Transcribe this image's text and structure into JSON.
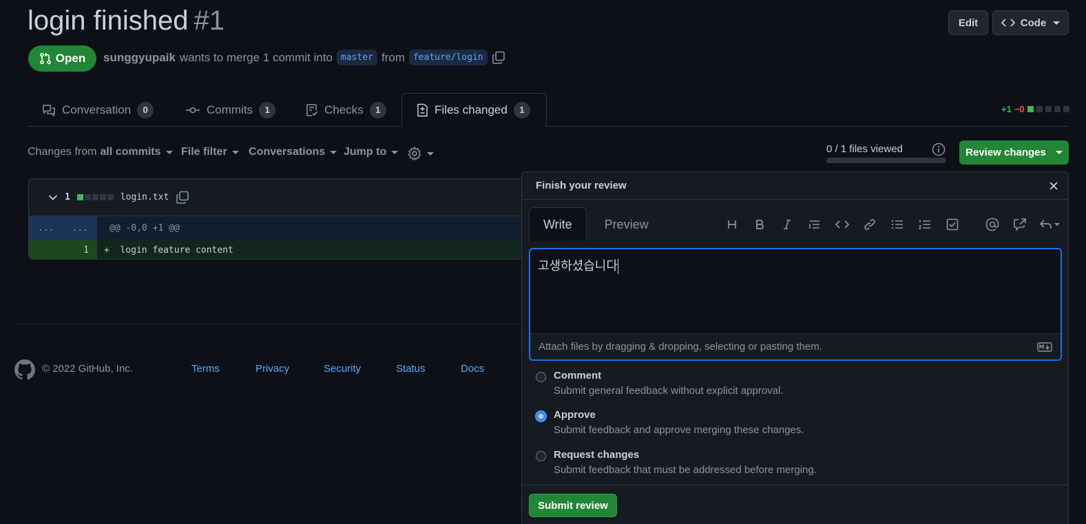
{
  "pr": {
    "title": "login finished",
    "number": "#1",
    "status": "Open",
    "author": "sunggyupaik",
    "merge_text": "wants to merge 1 commit into",
    "base_branch": "master",
    "from_text": "from",
    "head_branch": "feature/login"
  },
  "header_buttons": {
    "edit": "Edit",
    "code": "Code"
  },
  "tabs": [
    {
      "label": "Conversation",
      "count": "0"
    },
    {
      "label": "Commits",
      "count": "1"
    },
    {
      "label": "Checks",
      "count": "1"
    },
    {
      "label": "Files changed",
      "count": "1"
    }
  ],
  "diffstat": {
    "added": "+1",
    "removed": "−0",
    "colors": {
      "added": "#3fb950",
      "removed": "#f85149"
    }
  },
  "toolbar": {
    "changes_prefix": "Changes from",
    "changes_value": "all commits",
    "file_filter": "File filter",
    "conversations": "Conversations",
    "jump_to": "Jump to",
    "files_viewed": "0 / 1 files viewed",
    "review_changes": "Review changes"
  },
  "file": {
    "changes": "1",
    "name": "login.txt",
    "hunk_gutter_left": "...",
    "hunk_gutter_right": "...",
    "hunk_header": "@@ -0,0 +1 @@",
    "line_number": "1",
    "line_content": "+  login feature content"
  },
  "footer": {
    "copyright": "© 2022 GitHub, Inc.",
    "links": [
      "Terms",
      "Privacy",
      "Security",
      "Status",
      "Docs"
    ]
  },
  "review": {
    "title": "Finish your review",
    "tab_write": "Write",
    "tab_preview": "Preview",
    "text": "고생하셨습니다",
    "attach_hint": "Attach files by dragging & dropping, selecting or pasting them.",
    "options": [
      {
        "label": "Comment",
        "desc": "Submit general feedback without explicit approval.",
        "checked": false
      },
      {
        "label": "Approve",
        "desc": "Submit feedback and approve merging these changes.",
        "checked": true
      },
      {
        "label": "Request changes",
        "desc": "Submit feedback that must be addressed before merging.",
        "checked": false
      }
    ],
    "submit": "Submit review"
  },
  "colors": {
    "accent_green": "#238636",
    "link": "#58a6ff",
    "focus": "#1f6feb"
  }
}
